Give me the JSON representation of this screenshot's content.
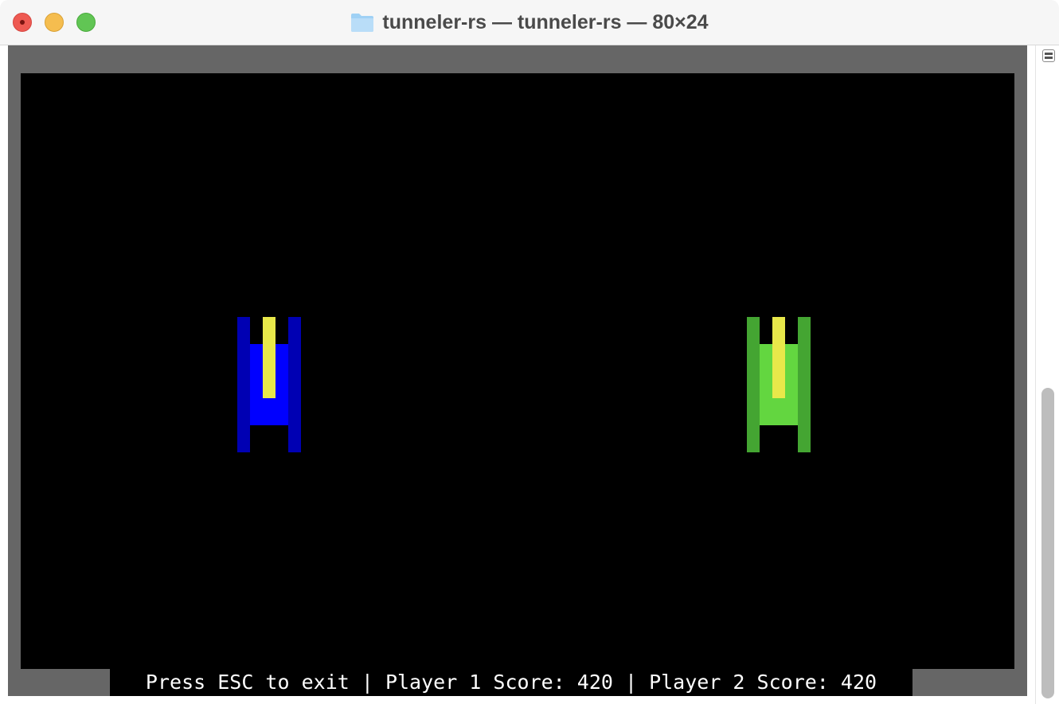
{
  "window": {
    "title": "tunneler-rs — tunneler-rs — 80×24",
    "icon": "folder-icon"
  },
  "terminal": {
    "status_line": "Press ESC to exit | Player 1 Score: 420 | Player 2 Score: 420",
    "colors": {
      "frame": "#666666",
      "field": "#000000",
      "player1_dark": "#0000b3",
      "player1_light": "#0000ff",
      "player2_dark": "#44a532",
      "player2_light": "#63d640",
      "cannon": "#e8e84a"
    }
  },
  "game": {
    "players": [
      {
        "id": "player-1",
        "score": 420
      },
      {
        "id": "player-2",
        "score": 420
      }
    ]
  }
}
